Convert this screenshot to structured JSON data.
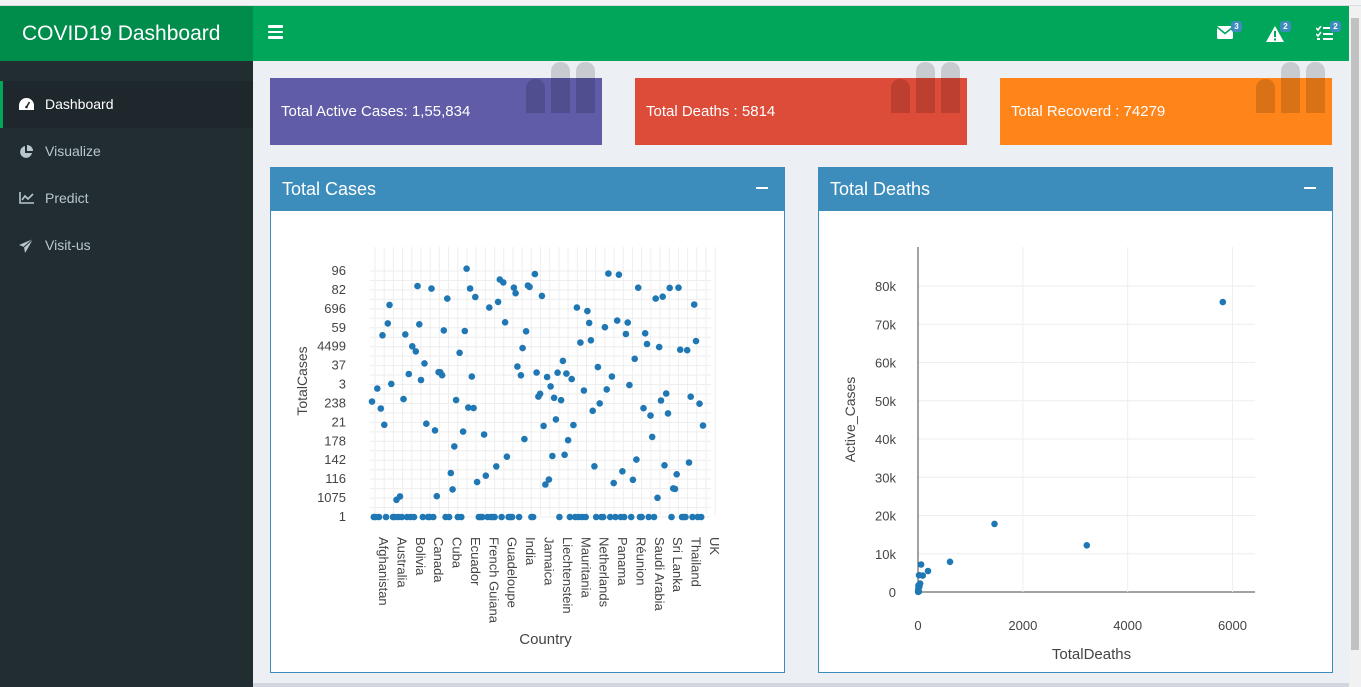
{
  "app": {
    "title": "COVID19 Dashboard"
  },
  "navbar": {
    "messages_count": "3",
    "alerts_count": "2",
    "tasks_count": "2"
  },
  "sidebar": {
    "items": [
      {
        "label": "Dashboard",
        "icon": "dashboard-icon",
        "active": true
      },
      {
        "label": "Visualize",
        "icon": "pie-chart-icon",
        "active": false
      },
      {
        "label": "Predict",
        "icon": "line-chart-icon",
        "active": false
      },
      {
        "label": "Visit-us",
        "icon": "paper-plane-icon",
        "active": false
      }
    ]
  },
  "stats": {
    "active": {
      "text": "Total Active Cases: 1,55,834",
      "color": "#605ca8"
    },
    "deaths": {
      "text": "Total Deaths : 5814",
      "color": "#dd4b39"
    },
    "recovered": {
      "text": "Total Recoverd : 74279",
      "color": "#ff851b"
    }
  },
  "panels": {
    "total_cases": {
      "title": "Total Cases"
    },
    "total_deaths": {
      "title": "Total Deaths"
    }
  },
  "chart_data": [
    {
      "type": "scatter",
      "title": "",
      "xlabel": "Country",
      "ylabel": "TotalCases",
      "x_tick_labels": [
        "Afghanistan",
        "Australia",
        "Bolivia",
        "Canada",
        "Cuba",
        "Ecuador",
        "French Guiana",
        "Guadeloupe",
        "India",
        "Jamaica",
        "Liechtenstein",
        "Mauritania",
        "Netherlands",
        "Panama",
        "Réunion",
        "Saudi Arabia",
        "Sri Lanka",
        "Thailand",
        "UK"
      ],
      "y_tick_labels": [
        "96",
        "82",
        "696",
        "59",
        "4499",
        "37",
        "3",
        "238",
        "21",
        "178",
        "142",
        "116",
        "1075",
        "1"
      ],
      "point_color": "#1f77b4",
      "point_count": 190,
      "note_on_points": "categorical y axis; points scattered across country categories"
    },
    {
      "type": "scatter",
      "title": "",
      "xlabel": "TotalDeaths",
      "ylabel": "Active_Cases",
      "xlim": [
        0,
        6200
      ],
      "ylim": [
        0,
        80000
      ],
      "x_ticks": [
        0,
        2000,
        4000,
        6000
      ],
      "y_ticks": [
        "0",
        "10k",
        "20k",
        "30k",
        "40k",
        "50k",
        "60k",
        "70k",
        "80k"
      ],
      "point_color": "#1f77b4",
      "points": [
        {
          "x": 5814,
          "y": 75800
        },
        {
          "x": 1460,
          "y": 17800
        },
        {
          "x": 3220,
          "y": 12200
        },
        {
          "x": 610,
          "y": 7900
        },
        {
          "x": 60,
          "y": 7200
        },
        {
          "x": 190,
          "y": 5500
        },
        {
          "x": 20,
          "y": 4400
        },
        {
          "x": 90,
          "y": 4300
        },
        {
          "x": 40,
          "y": 2200
        },
        {
          "x": 25,
          "y": 1400
        },
        {
          "x": 10,
          "y": 900
        },
        {
          "x": 5,
          "y": 500
        },
        {
          "x": 3,
          "y": 300
        },
        {
          "x": 15,
          "y": 100
        },
        {
          "x": 8,
          "y": 1700
        },
        {
          "x": 2,
          "y": 50
        }
      ]
    }
  ]
}
